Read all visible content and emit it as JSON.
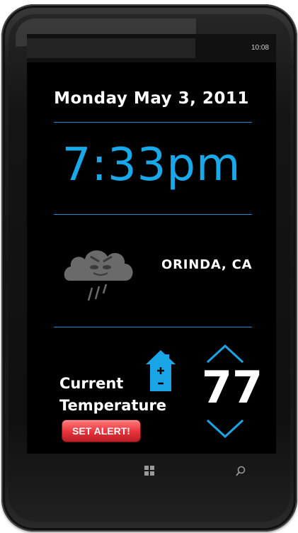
{
  "status_bar": {
    "time": "10:08"
  },
  "date": "Monday May 3, 2011",
  "time": "7:33pm",
  "weather": {
    "icon": "storm-cloud-rain-icon",
    "location": "ORINDA, CA"
  },
  "thermostat": {
    "label_line1": "Current",
    "label_line2": "Temperature",
    "value": "77",
    "alert_button": "SET ALERT!"
  },
  "colors": {
    "accent_blue": "#17a9ea",
    "divider_blue": "#1a89c9",
    "alert_red": "#e8323a",
    "screen_bg": "#000000",
    "cloud_gray": "#6a6a6a"
  },
  "icons": [
    "storm-cloud-rain-icon",
    "house-icon",
    "chevron-up-icon",
    "chevron-down-icon",
    "windows-icon",
    "search-icon"
  ]
}
